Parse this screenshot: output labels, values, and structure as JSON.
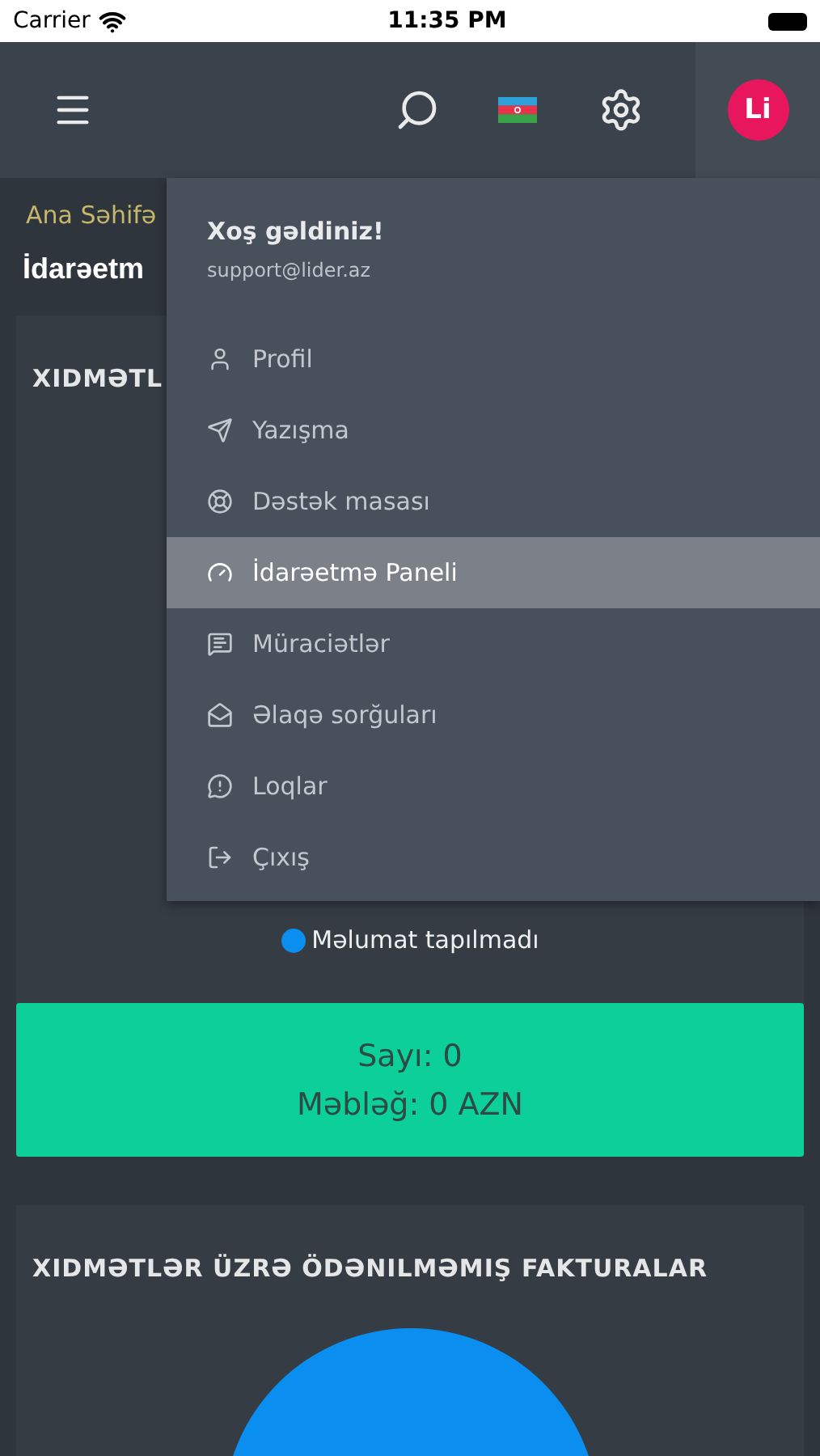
{
  "status_bar": {
    "carrier": "Carrier",
    "time": "11:35 PM"
  },
  "header": {
    "avatar": "Li"
  },
  "breadcrumb": "Ana Səhifə",
  "page_title": "İdarəetm",
  "cards": [
    {
      "title": "XIDMƏTL",
      "legend": [
        {
          "label": "Məlumat tapılmadı",
          "color": "#0a8ff0"
        }
      ],
      "summary": [
        "Sayı: 0",
        "Məbləğ: 0 AZN"
      ]
    },
    {
      "title": "XIDMƏTLƏR ÜZRƏ ÖDƏNILMƏMIŞ FAKTURALAR"
    }
  ],
  "user_menu": {
    "greeting": "Xoş gəldiniz!",
    "email": "support@lider.az",
    "items": [
      {
        "label": "Profil",
        "selected": false
      },
      {
        "label": "Yazışma",
        "selected": false
      },
      {
        "label": "Dəstək masası",
        "selected": false
      },
      {
        "label": "İdarəetmə Paneli",
        "selected": true
      },
      {
        "label": "Müraciətlər",
        "selected": false
      },
      {
        "label": "Əlaqə sorğuları",
        "selected": false
      },
      {
        "label": "Loqlar",
        "selected": false
      },
      {
        "label": "Çıxış",
        "selected": false
      }
    ]
  }
}
